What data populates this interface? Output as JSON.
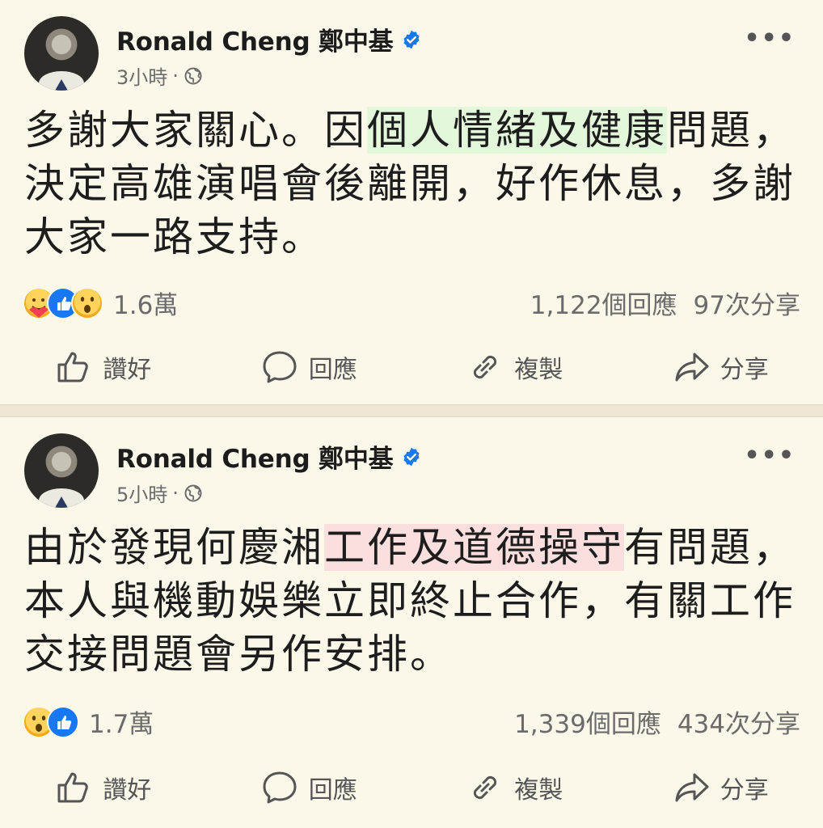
{
  "posts": [
    {
      "author": "Ronald Cheng 鄭中基",
      "time": "3小時",
      "dot": "·",
      "text_before": "多謝大家關心。因",
      "text_highlight": "個人情緒及健康",
      "text_after": "問題，決定高雄演唱會後離開，好作休息，多謝大家一路支持。",
      "highlight_color": "#e3f7da",
      "reactions": [
        "care",
        "like",
        "wow"
      ],
      "reaction_count": "1.6萬",
      "comments": "1,122個回應",
      "shares": "97次分享"
    },
    {
      "author": "Ronald Cheng 鄭中基",
      "time": "5小時",
      "dot": "·",
      "text_before": "由於發現何慶湘",
      "text_highlight": "工作及道德操守",
      "text_after": "有問題，本人與機動娛樂立即終止合作，有關工作交接問題會另作安排。",
      "highlight_color": "#fbdede",
      "reactions": [
        "wow",
        "like"
      ],
      "reaction_count": "1.7萬",
      "comments": "1,339個回應",
      "shares": "434次分享"
    }
  ],
  "actions": {
    "like": "讚好",
    "comment": "回應",
    "copy": "複製",
    "share": "分享"
  },
  "icons": {
    "more": "more-horizontal-icon",
    "verified": "verified-badge-icon",
    "privacy": "globe-icon",
    "like": "thumbs-up-icon",
    "comment": "speech-bubble-icon",
    "copy": "link-icon",
    "share": "share-arrow-icon"
  },
  "colors": {
    "background": "#fbf7e9",
    "verified": "#1877f2",
    "like_reaction": "#1877f2"
  }
}
